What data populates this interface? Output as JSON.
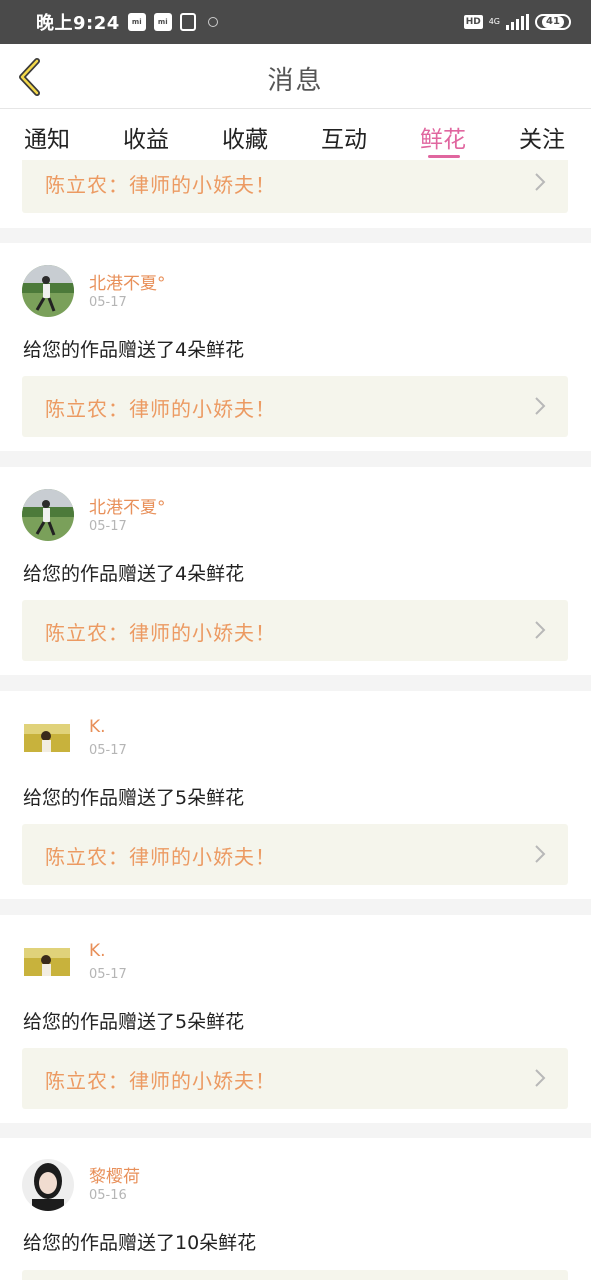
{
  "status_bar": {
    "time": "晚上9:24",
    "hd": "HD",
    "network": "4G",
    "battery": "41"
  },
  "header": {
    "title": "消息"
  },
  "tabs": [
    {
      "label": "通知",
      "active": false
    },
    {
      "label": "收益",
      "active": false
    },
    {
      "label": "收藏",
      "active": false
    },
    {
      "label": "互动",
      "active": false
    },
    {
      "label": "鲜花",
      "active": true
    },
    {
      "label": "关注",
      "active": false
    }
  ],
  "colors": {
    "accent": "#e0669f",
    "username": "#e8905a",
    "work_title": "#ec9a62",
    "work_box_bg": "#f5f5ec"
  },
  "partial_card": {
    "work_title": "陈立农：律师的小娇夫！"
  },
  "messages": [
    {
      "user": "北港不夏°",
      "date": "05-17",
      "text": "给您的作品赠送了4朵鲜花",
      "work_title": "陈立农：律师的小娇夫！"
    },
    {
      "user": "北港不夏°",
      "date": "05-17",
      "text": "给您的作品赠送了4朵鲜花",
      "work_title": "陈立农：律师的小娇夫！"
    },
    {
      "user": "K.",
      "date": "05-17",
      "text": "给您的作品赠送了5朵鲜花",
      "work_title": "陈立农：律师的小娇夫！"
    },
    {
      "user": "K.",
      "date": "05-17",
      "text": "给您的作品赠送了5朵鲜花",
      "work_title": "陈立农：律师的小娇夫！"
    },
    {
      "user": "黎樱荷",
      "date": "05-16",
      "text": "给您的作品赠送了10朵鲜花"
    }
  ]
}
